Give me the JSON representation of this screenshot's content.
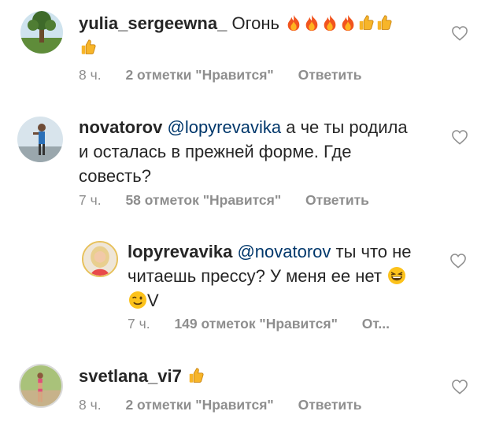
{
  "comments": [
    {
      "username": "yulia_sergeewna_",
      "text": "Огонь",
      "time": "8 ч.",
      "likes": "2 отметки \"Нравится\"",
      "reply": "Ответить"
    },
    {
      "username": "novatorov",
      "mention": "@lopyrevavika",
      "text_line1": " а че ты родила",
      "text_line2": "и осталась в прежней форме. Где",
      "text_line3": "совесть?",
      "time": "7 ч.",
      "likes": "58 отметок \"Нравится\"",
      "reply": "Ответить"
    },
    {
      "username": "lopyrevavika",
      "mention": "@novatorov",
      "text_line1": " ты что не",
      "text_line2": "читаешь прессу? У меня ее нет",
      "text_line3": "V",
      "time": "7 ч.",
      "likes": "149 отметок \"Нравится\"",
      "reply": "От..."
    },
    {
      "username": "svetlana_vi7",
      "text": "",
      "time": "8 ч.",
      "likes": "2 отметки \"Нравится\"",
      "reply": "Ответить"
    }
  ],
  "icons": {
    "like": "heart-outline-icon",
    "fire": "fire-emoji-icon",
    "thumbs": "thumbs-up-emoji-icon",
    "laugh": "laughing-emoji-icon",
    "wink": "winking-emoji-icon"
  },
  "colors": {
    "text": "#262626",
    "meta": "#8e8e8e",
    "mention": "#00376b"
  }
}
